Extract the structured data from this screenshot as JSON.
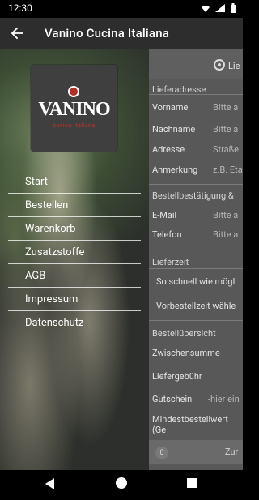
{
  "status": {
    "time": "12:30"
  },
  "app": {
    "title": "Vanino Cucina Italiana"
  },
  "logo": {
    "text": "VANINO",
    "subtitle": "cucina italiana"
  },
  "menu": [
    "Start",
    "Bestellen",
    "Warenkorb",
    "Zusatzstoffe",
    "AGB",
    "Impressum",
    "Datenschutz"
  ],
  "form": {
    "radio_label": "Lie",
    "sections": {
      "address": "Lieferadresse",
      "confirm": "Bestellbestätigung &",
      "time": "Lieferzeit",
      "overview": "Bestellübersicht"
    },
    "fields": [
      {
        "label": "Vorname",
        "placeholder": "Bitte a"
      },
      {
        "label": "Nachname",
        "placeholder": "Bitte a"
      },
      {
        "label": "Adresse",
        "placeholder": "Straße"
      },
      {
        "label": "Anmerkung",
        "placeholder": "z.B. Eta"
      }
    ],
    "contact_fields": [
      {
        "label": "E-Mail",
        "placeholder": "Bitte a"
      },
      {
        "label": "Telefon",
        "placeholder": "Bitte a"
      }
    ],
    "time_options": [
      "So schnell wie mögl",
      "Vorbestellzeit wähle"
    ],
    "summary": {
      "subtotal": "Zwischensumme",
      "delivery_fee": "Liefergebühr",
      "voucher_label": "Gutschein",
      "voucher_placeholder": "-hier ein",
      "minimum_order": "Mindestbestellwert (Ge"
    },
    "bottom": {
      "count": "0",
      "button": "Zur"
    }
  }
}
